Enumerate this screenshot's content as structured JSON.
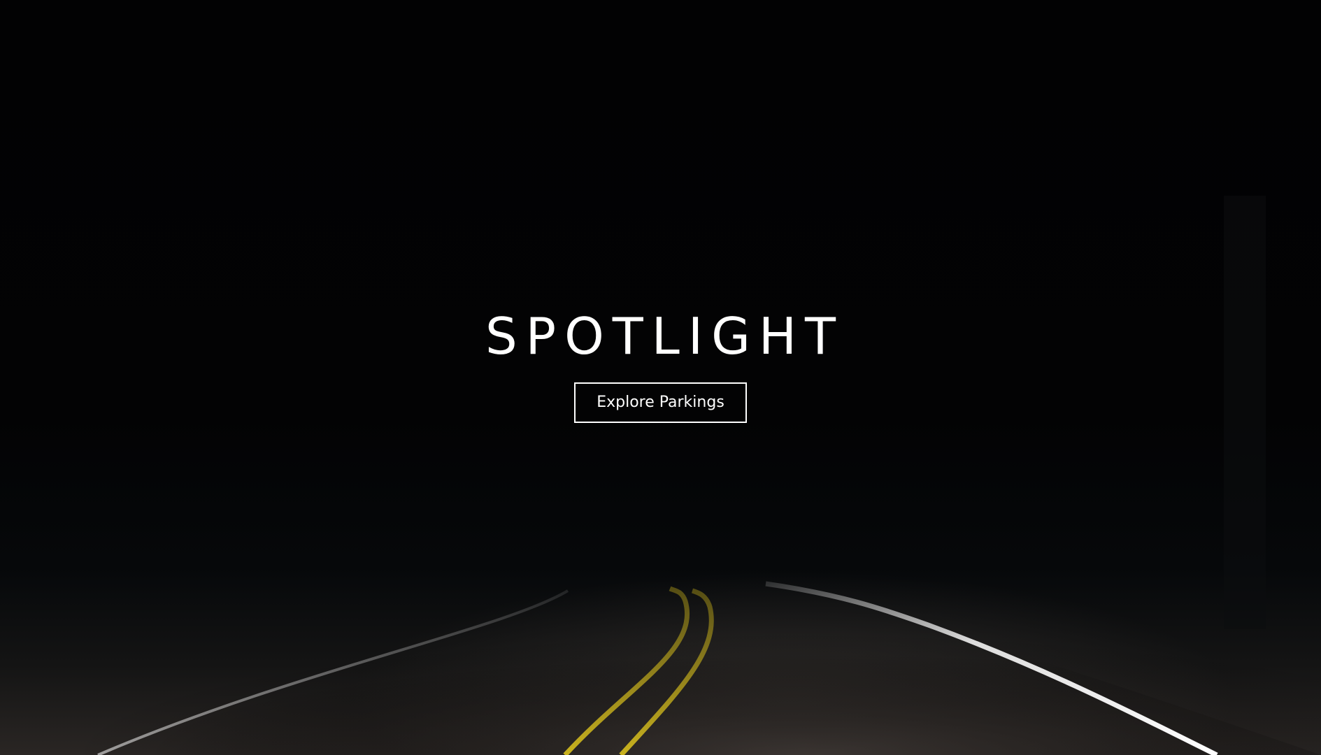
{
  "hero": {
    "title": "SPOTLIGHT",
    "cta_label": "Explore Parkings"
  },
  "colors": {
    "background": "#030304",
    "text": "#ffffff",
    "road_center_line": "#c9b21e",
    "road_edge_line": "#d9d9d9"
  }
}
